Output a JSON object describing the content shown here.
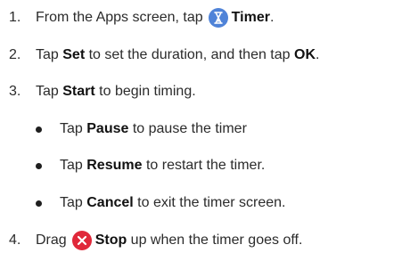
{
  "steps": [
    {
      "num": "1.",
      "pre": "From the Apps screen, tap",
      "icon": "timer-icon",
      "bold": "Timer",
      "post": "."
    },
    {
      "num": "2.",
      "pre": "Tap ",
      "bold": "Set",
      "mid": " to set the duration, and then tap ",
      "bold2": "OK",
      "post": "."
    },
    {
      "num": "3.",
      "pre": "Tap ",
      "bold": "Start",
      "post": " to begin timing."
    },
    {
      "num": "4.",
      "pre": "Drag",
      "icon": "stop-icon",
      "bold": "Stop",
      "post": " up when the timer goes off."
    }
  ],
  "bullets": [
    {
      "pre": "Tap ",
      "bold": "Pause",
      "post": " to pause the timer"
    },
    {
      "pre": "Tap ",
      "bold": "Resume",
      "post": " to restart the timer."
    },
    {
      "pre": "Tap ",
      "bold": "Cancel",
      "post": " to exit the timer screen."
    }
  ],
  "colors": {
    "timer_icon": "#4f83d8",
    "stop_icon": "#e0283a"
  }
}
